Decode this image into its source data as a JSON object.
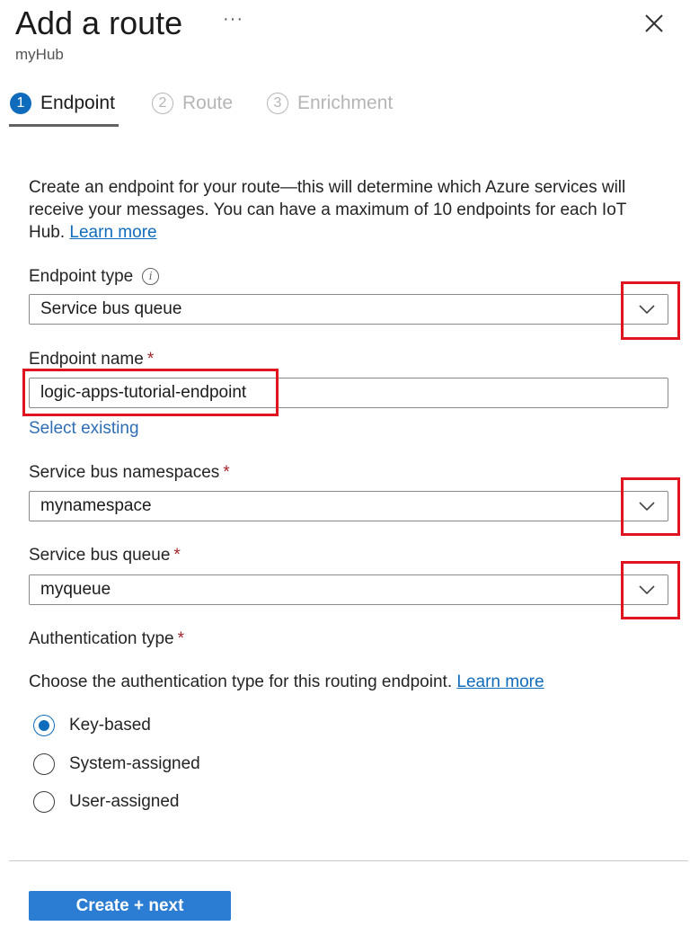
{
  "header": {
    "title": "Add a route",
    "more_label": "···",
    "subtitle": "myHub"
  },
  "steps": [
    {
      "number": "1",
      "label": "Endpoint",
      "state": "active"
    },
    {
      "number": "2",
      "label": "Route",
      "state": "inactive"
    },
    {
      "number": "3",
      "label": "Enrichment",
      "state": "inactive"
    }
  ],
  "intro": {
    "text": "Create an endpoint for your route—this will determine which Azure services will receive your messages. You can have a maximum of 10 endpoints for each IoT Hub.",
    "link": "Learn more"
  },
  "form": {
    "endpoint_type": {
      "label": "Endpoint type",
      "value": "Service bus queue"
    },
    "endpoint_name": {
      "label": "Endpoint name",
      "required": "*",
      "value": "logic-apps-tutorial-endpoint"
    },
    "select_existing": "Select existing",
    "namespaces": {
      "label": "Service bus namespaces",
      "required": "*",
      "value": "mynamespace"
    },
    "queue": {
      "label": "Service bus queue",
      "required": "*",
      "value": "myqueue"
    },
    "auth_type": {
      "label": "Authentication type",
      "required": "*"
    },
    "auth_desc": {
      "text": "Choose the authentication type for this routing endpoint.",
      "link": "Learn more"
    },
    "auth_options": [
      {
        "label": "Key-based",
        "checked": true
      },
      {
        "label": "System-assigned",
        "checked": false
      },
      {
        "label": "User-assigned",
        "checked": false
      }
    ]
  },
  "footer": {
    "create_label": "Create + next"
  },
  "colors": {
    "accent": "#0f6cbd",
    "button": "#2b7cd3",
    "highlight": "#e0141e",
    "required": "#a4262c"
  }
}
